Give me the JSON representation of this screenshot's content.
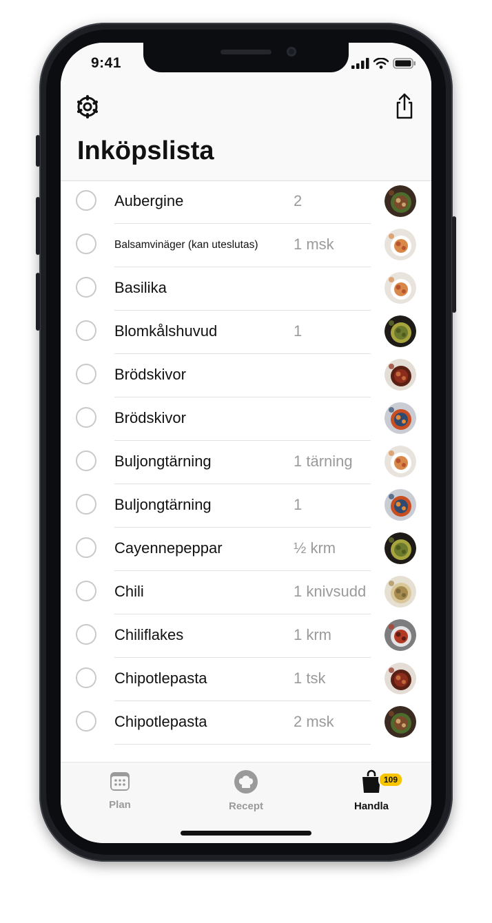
{
  "status_bar": {
    "time": "9:41"
  },
  "header": {
    "title": "Inköpslista",
    "settings_icon": "settings-icon",
    "share_icon": "share-icon"
  },
  "items": [
    {
      "name": "Aubergine",
      "qty": "2",
      "small": false,
      "thumb": "dark-stew"
    },
    {
      "name": "Balsamvinäger (kan uteslutas)",
      "qty": "1 msk",
      "small": true,
      "thumb": "pasta-plate"
    },
    {
      "name": "Basilika",
      "qty": "",
      "small": false,
      "thumb": "pasta-plate"
    },
    {
      "name": "Blomkålshuvud",
      "qty": "1",
      "small": false,
      "thumb": "green-veg"
    },
    {
      "name": "Brödskivor",
      "qty": "",
      "small": false,
      "thumb": "red-stew"
    },
    {
      "name": "Brödskivor",
      "qty": "",
      "small": false,
      "thumb": "soup-bowl"
    },
    {
      "name": "Buljongtärning",
      "qty": "1 tärning",
      "small": false,
      "thumb": "pasta-plate"
    },
    {
      "name": "Buljongtärning",
      "qty": "1",
      "small": false,
      "thumb": "soup-bowl"
    },
    {
      "name": "Cayennepeppar",
      "qty": "½ krm",
      "small": false,
      "thumb": "green-veg"
    },
    {
      "name": "Chili",
      "qty": "1 knivsudd",
      "small": false,
      "thumb": "light-bowls"
    },
    {
      "name": "Chiliflakes",
      "qty": "1 krm",
      "small": false,
      "thumb": "red-bowl"
    },
    {
      "name": "Chipotlepasta",
      "qty": "1 tsk",
      "small": false,
      "thumb": "red-stew"
    },
    {
      "name": "Chipotlepasta",
      "qty": "2 msk",
      "small": false,
      "thumb": "dark-stew"
    }
  ],
  "tabs": [
    {
      "label": "Plan",
      "icon": "calendar-icon",
      "active": false
    },
    {
      "label": "Recept",
      "icon": "chef-hat-icon",
      "active": false
    },
    {
      "label": "Handla",
      "icon": "shopping-bag-icon",
      "active": true,
      "badge": "109"
    }
  ],
  "colors": {
    "accent": "#f7c400",
    "text": "#111111",
    "muted": "#9a9a9a",
    "frame": "#1d1f24"
  }
}
